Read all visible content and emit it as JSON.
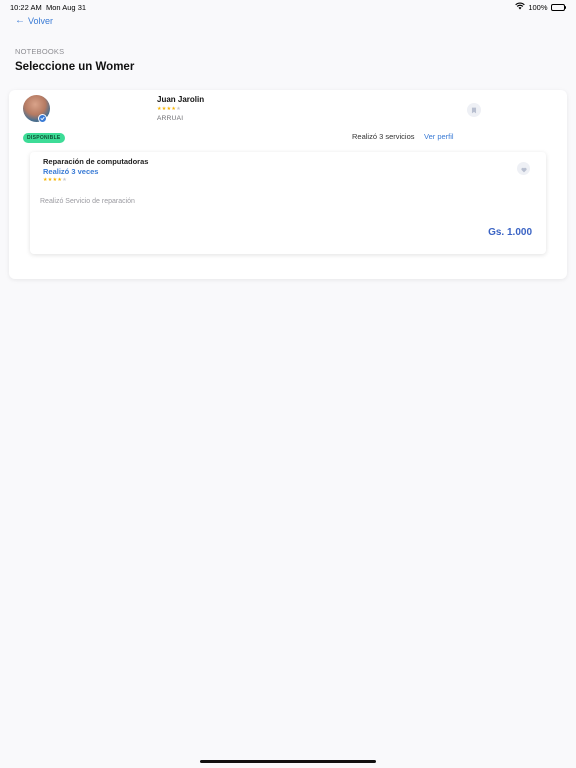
{
  "status_bar": {
    "time": "10:22 AM",
    "date": "Mon Aug 31",
    "battery": "100%",
    "battery_level": 1.0,
    "icons": [
      "wifi-icon",
      "battery-icon"
    ]
  },
  "header": {
    "back_label": "Volver",
    "category": "NOTEBOOKS",
    "title": "Seleccione un Womer"
  },
  "provider": {
    "name": "Juan Jarolin",
    "rating": 4,
    "rating_max": 5,
    "location": "ARRUAI",
    "status_badge": "DISPONIBLE",
    "services_count_text": "Realizó 3 servicios",
    "view_profile_label": "Ver perfil",
    "verified": true
  },
  "service": {
    "title": "Reparación de computadoras",
    "times_text": "Realizó 3 veces",
    "rating": 4,
    "rating_max": 5,
    "description": "Realizó Servicio de reparación",
    "price": "Gs. 1.000"
  },
  "colors": {
    "accent": "#3a7bd5",
    "price": "#3a63c4",
    "badge": "#3ddc97",
    "star": "#f5b301"
  }
}
